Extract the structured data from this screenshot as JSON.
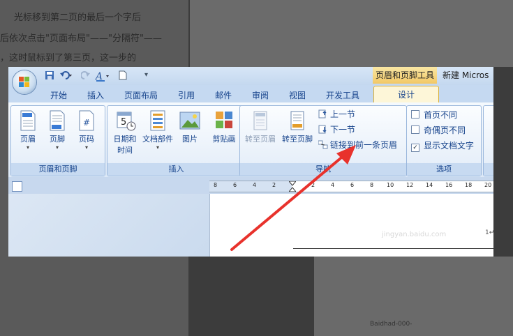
{
  "background": {
    "lines": [
      "光标移到第二页的最后一个字后",
      "后依次点击\"页面布局\"——\"分隔符\"——",
      "，这时鼠标到了第三页，这一步的"
    ],
    "footer_text": "Baidhad-000-"
  },
  "window": {
    "ctx_tab_title": "页眉和页脚工具",
    "doc_title": "新建 Micros"
  },
  "tabs": [
    "开始",
    "插入",
    "页面布局",
    "引用",
    "邮件",
    "审阅",
    "视图",
    "开发工具"
  ],
  "active_tab": "设计",
  "groups": {
    "header_footer": {
      "label": "页眉和页脚",
      "buttons": [
        "页眉",
        "页脚",
        "页码"
      ]
    },
    "insert": {
      "label": "插入",
      "datetime_line1": "日期和",
      "datetime_line2": "时间",
      "docparts": "文档部件",
      "picture": "图片",
      "clipart": "剪贴画"
    },
    "navigation": {
      "label": "导航",
      "goto_header": "转至页眉",
      "goto_footer": "转至页脚",
      "prev": "上一节",
      "next": "下一节",
      "link_prev": "链接到前一条页眉"
    },
    "options": {
      "label": "选项",
      "items": [
        {
          "label": "首页不同",
          "checked": false
        },
        {
          "label": "奇偶页不同",
          "checked": false
        },
        {
          "label": "显示文档文字",
          "checked": true
        }
      ]
    }
  },
  "ruler": {
    "ticks": [
      "8",
      "6",
      "4",
      "2",
      "2",
      "4",
      "6",
      "8",
      "10",
      "12",
      "14",
      "16",
      "18",
      "20"
    ]
  },
  "document": {
    "watermark": "jingyan.baidu.com",
    "para_mark": "1↵"
  },
  "colors": {
    "arrow": "#e8322c",
    "ctx_tab": "#f2c866",
    "ribbon_text": "#15428b"
  }
}
